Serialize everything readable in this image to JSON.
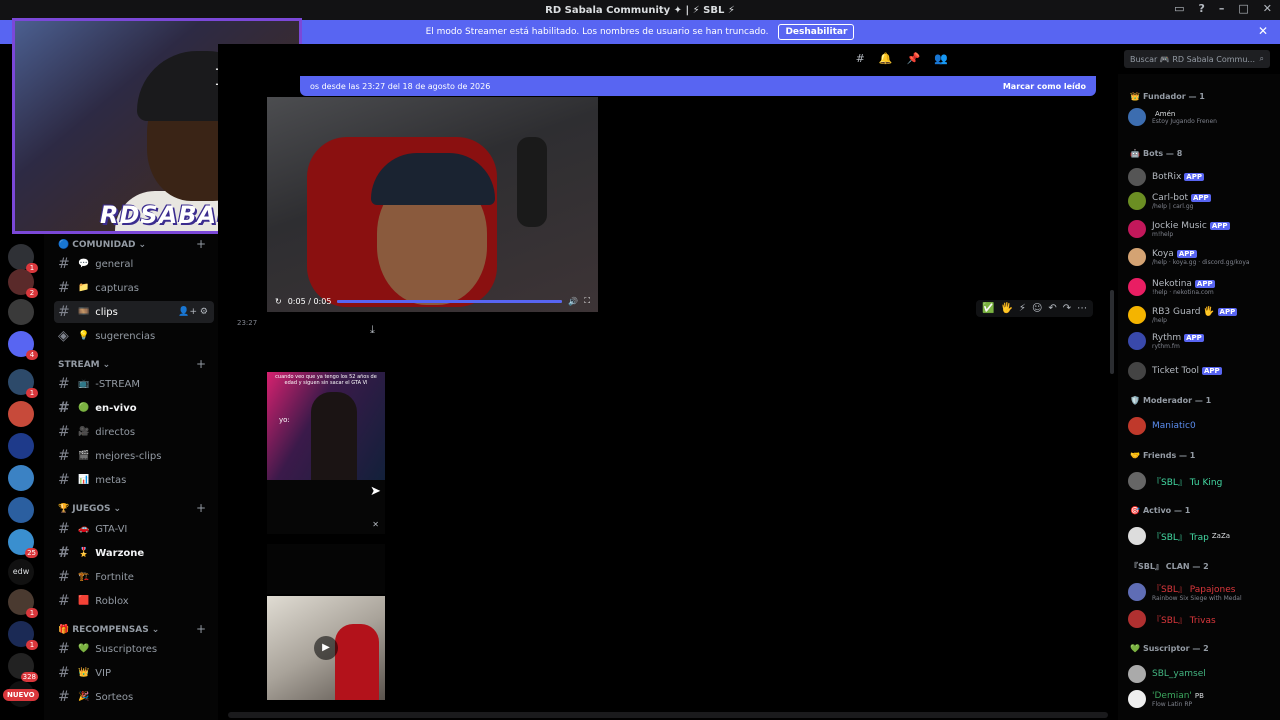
{
  "title": "RD Sabala Community ✦ | ⚡ SBL ⚡",
  "streamer_bar": {
    "message": "El modo Streamer está habilitado. Los nombres de usuario se han truncado.",
    "button": "Deshabilitar"
  },
  "search": {
    "placeholder": "Buscar 🎮 RD Sabala Commu..."
  },
  "webcam": {
    "brand": "RDSABALA",
    "cap_logo": "NY"
  },
  "servers": {
    "badges": [
      "1",
      "2",
      "4",
      "1",
      "25",
      "1",
      "1",
      "328"
    ],
    "edw_label": "edw",
    "nuevo": "NUEVO"
  },
  "channels": {
    "categories": [
      {
        "label": "COMUNIDAD",
        "emoji": "🔵"
      },
      {
        "label": "STREAM",
        "emoji": ""
      },
      {
        "label": "JUEGOS",
        "emoji": "🏆"
      },
      {
        "label": "RECOMPENSAS",
        "emoji": "🎁"
      }
    ],
    "items": [
      {
        "label": "general",
        "emoji": "💬",
        "state": "normal"
      },
      {
        "label": "capturas",
        "emoji": "📁",
        "state": "normal"
      },
      {
        "label": "clips",
        "emoji": "🎞️",
        "state": "active"
      },
      {
        "label": "sugerencias",
        "emoji": "💡",
        "state": "normal"
      },
      {
        "label": "-STREAM",
        "emoji": "📺",
        "state": "normal"
      },
      {
        "label": "en-vivo",
        "emoji": "🟢",
        "state": "bold"
      },
      {
        "label": "directos",
        "emoji": "🎥",
        "state": "normal"
      },
      {
        "label": "mejores-clips",
        "emoji": "🎬",
        "state": "normal"
      },
      {
        "label": "metas",
        "emoji": "📊",
        "state": "normal"
      },
      {
        "label": "GTA-VI",
        "emoji": "🚗",
        "state": "normal"
      },
      {
        "label": "Warzone",
        "emoji": "🎖️",
        "state": "bold"
      },
      {
        "label": "Fortnite",
        "emoji": "🏗️",
        "state": "normal"
      },
      {
        "label": "Roblox",
        "emoji": "🟥",
        "state": "normal"
      },
      {
        "label": "Suscriptores",
        "emoji": "💚",
        "state": "normal"
      },
      {
        "label": "VIP",
        "emoji": "👑",
        "state": "normal"
      },
      {
        "label": "Sorteos",
        "emoji": "🎉",
        "state": "normal"
      }
    ]
  },
  "chat": {
    "new_messages": "os desde las 23:27 del 18 de agosto de 2026",
    "mark_read": "Marcar como leído",
    "video_time": "0:05 / 0:05",
    "video_progress": 1.0,
    "timestamp": "23:27",
    "clip2_caption": "cuando veo que ya tengo los 52 años de edad y siguen sin sacar el GTA VI",
    "clip2_yo": "yo:"
  },
  "members": {
    "groups": [
      {
        "label": "Fundador — 1",
        "emoji": "👑",
        "members": [
          {
            "name": "",
            "sub": "Estoy Jugando Frenen",
            "tag": "Amén",
            "color": "#b5bac1",
            "avatar": "#3c6db0"
          }
        ]
      },
      {
        "label": "Bots — 8",
        "emoji": "🤖",
        "members": [
          {
            "name": "BotRix",
            "sub": "",
            "tag": "APP",
            "color": "#b5bac1",
            "avatar": "#555"
          },
          {
            "name": "Carl-bot",
            "sub": "/help | carl.gg",
            "tag": "APP",
            "color": "#b5bac1",
            "avatar": "#6b8e23"
          },
          {
            "name": "Jockie Music",
            "sub": "m!help",
            "tag": "APP",
            "color": "#b5bac1",
            "avatar": "#c2185b"
          },
          {
            "name": "Koya",
            "sub": "/help · koya.gg · discord.gg/koya",
            "tag": "APP",
            "color": "#b5bac1",
            "avatar": "#d4a373"
          },
          {
            "name": "Nekotina",
            "sub": "!help · nekotina.com",
            "tag": "APP",
            "color": "#b5bac1",
            "avatar": "#e91e63"
          },
          {
            "name": "RB3 Guard 🖐️",
            "sub": "/help",
            "tag": "APP",
            "color": "#b5bac1",
            "avatar": "#f4b400"
          },
          {
            "name": "Rythm",
            "sub": "rythm.fm",
            "tag": "APP",
            "color": "#b5bac1",
            "avatar": "#3949ab"
          },
          {
            "name": "Ticket Tool",
            "sub": "",
            "tag": "APP",
            "color": "#b5bac1",
            "avatar": "#444"
          }
        ]
      },
      {
        "label": "Moderador — 1",
        "emoji": "🛡️",
        "members": [
          {
            "name": "Maniatic0",
            "sub": "",
            "tag": "",
            "color": "#5b8def",
            "avatar": "#c0392b"
          }
        ]
      },
      {
        "label": "Friends — 1",
        "emoji": "🤝",
        "members": [
          {
            "name": "『SBL』 Tu King",
            "sub": "",
            "tag": "",
            "color": "#43d9a3",
            "avatar": "#666"
          }
        ]
      },
      {
        "label": "Activo — 1",
        "emoji": "🎯",
        "members": [
          {
            "name": "『SBL』 Trap",
            "sub": "",
            "tag": "ZaZa",
            "color": "#43d9a3",
            "avatar": "#ddd"
          }
        ]
      },
      {
        "label": "『SBL』 CLAN — 2",
        "emoji": "",
        "members": [
          {
            "name": "『SBL』 Papajones",
            "sub": "Rainbow Six Siege with Medal",
            "tag": "",
            "color": "#da373c",
            "avatar": "#5f6db5"
          },
          {
            "name": "『SBL』 Trivas",
            "sub": "",
            "tag": "",
            "color": "#da373c",
            "avatar": "#b03030"
          }
        ]
      },
      {
        "label": "Suscriptor — 2",
        "emoji": "💚",
        "members": [
          {
            "name": "SBL_yamsel",
            "sub": "",
            "tag": "",
            "color": "#43b581",
            "avatar": "#aaa"
          },
          {
            "name": "'Demian'",
            "sub": "Flow Latin RP",
            "tag": "PB",
            "color": "#3ba55d",
            "avatar": "#eee"
          }
        ]
      }
    ]
  },
  "colors": {
    "accent": "#5865f2",
    "webcam_border": "#7b48d8",
    "danger": "#da373c"
  }
}
